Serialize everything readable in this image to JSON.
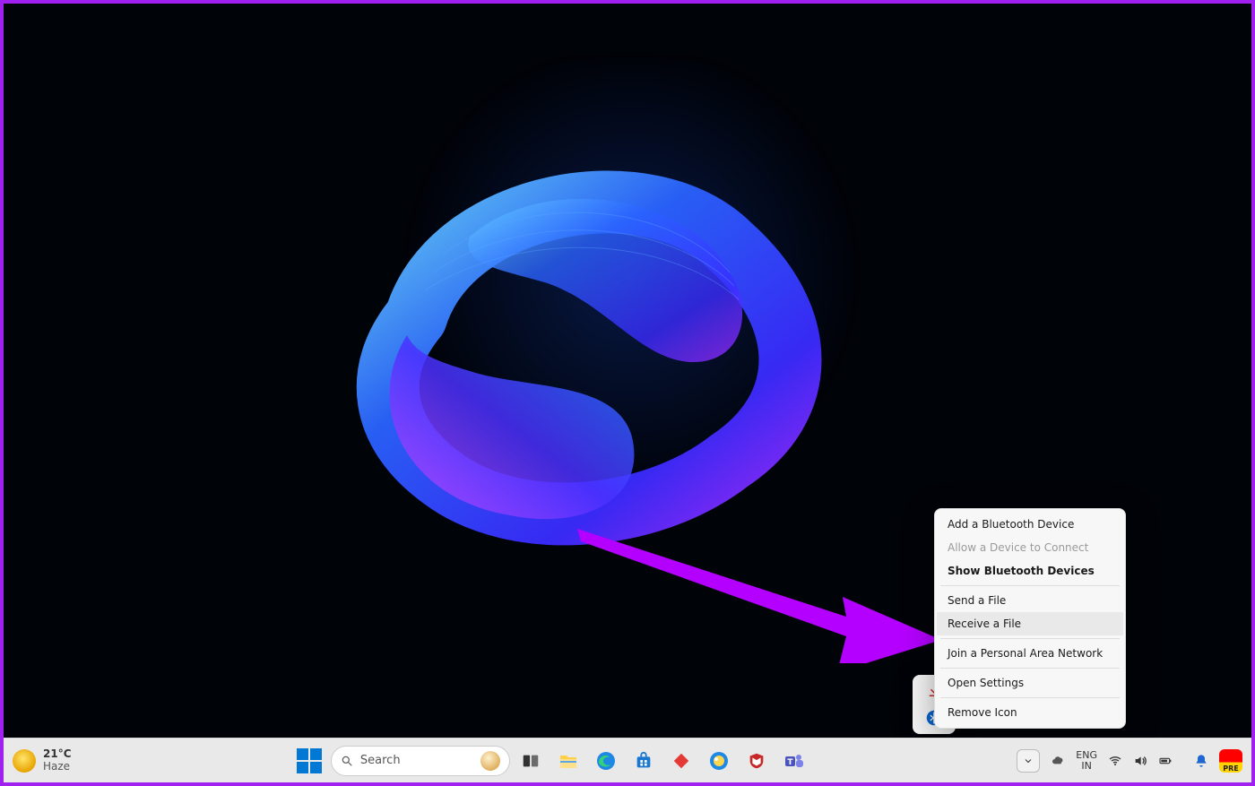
{
  "weather": {
    "temp": "21°C",
    "condition": "Haze"
  },
  "search": {
    "placeholder": "Search"
  },
  "language": {
    "line1": "ENG",
    "line2": "IN"
  },
  "clock": {
    "line1": "",
    "line2": ""
  },
  "copilot_badge": "PRE",
  "context_menu": {
    "items": [
      {
        "label": "Add a Bluetooth Device",
        "bold": false,
        "disabled": false,
        "highlight": false
      },
      {
        "label": "Allow a Device to Connect",
        "bold": false,
        "disabled": true,
        "highlight": false
      },
      {
        "label": "Show Bluetooth Devices",
        "bold": true,
        "disabled": false,
        "highlight": false
      },
      {
        "sep": true
      },
      {
        "label": "Send a File",
        "bold": false,
        "disabled": false,
        "highlight": false
      },
      {
        "label": "Receive a File",
        "bold": false,
        "disabled": false,
        "highlight": true
      },
      {
        "sep": true
      },
      {
        "label": "Join a Personal Area Network",
        "bold": false,
        "disabled": false,
        "highlight": false
      },
      {
        "sep": true
      },
      {
        "label": "Open Settings",
        "bold": false,
        "disabled": false,
        "highlight": false
      },
      {
        "sep": true
      },
      {
        "label": "Remove Icon",
        "bold": false,
        "disabled": false,
        "highlight": false
      }
    ]
  },
  "tray_popup_icons": [
    "download-icon",
    "bluetooth-icon"
  ],
  "taskbar_apps": [
    "task-view-icon",
    "file-explorer-icon",
    "edge-icon",
    "store-icon",
    "todo-icon",
    "photos-icon",
    "mcafee-icon",
    "teams-icon"
  ],
  "right_status_icons": [
    "onedrive-icon",
    "wifi-icon",
    "volume-icon",
    "battery-icon"
  ],
  "annotation_arrow_color": "#B400FF"
}
